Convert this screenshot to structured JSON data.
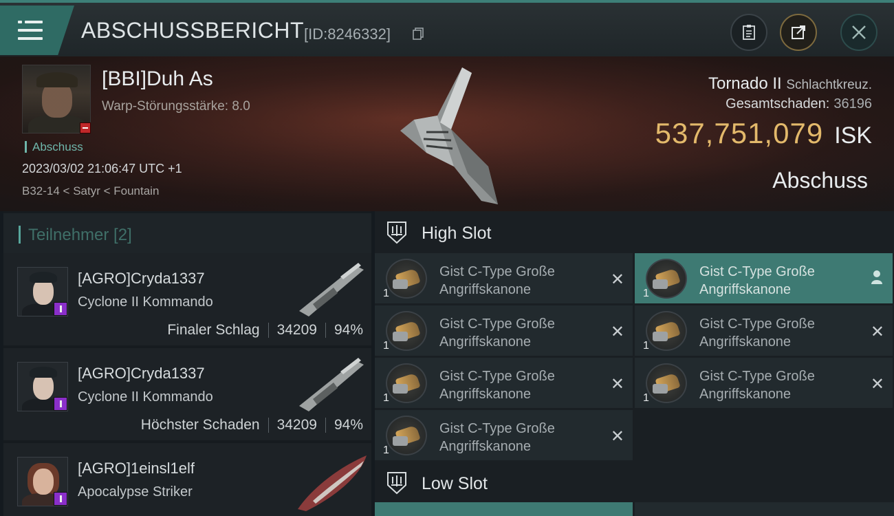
{
  "header": {
    "title": "ABSCHUSSBERICHT",
    "id_label": "[ID:8246332]",
    "icons": [
      "menu-icon",
      "copy-icon",
      "clipboard-icon",
      "share-icon",
      "close-icon"
    ]
  },
  "victim": {
    "name": "[BBI]Duh As",
    "warp_strength": "Warp-Störungsstärke: 8.0",
    "kill_tag": "Abschuss",
    "datetime": "2023/03/02 21:06:47 UTC +1",
    "location": "B32-14 < Satyr < Fountain",
    "ship": "Tornado II",
    "ship_class": "Schlachtkreuz.",
    "total_damage_label": "Gesamtschaden:",
    "total_damage": "36196",
    "isk_value": "537,751,079",
    "isk_unit": "ISK",
    "result": "Abschuss"
  },
  "participants": {
    "label": "Teilnehmer [2]",
    "rows": [
      {
        "name": "[AGRO]Cryda1337",
        "ship": "Cyclone II Kommando",
        "role": "Finaler Schlag",
        "damage": "34209",
        "percent": "94%"
      },
      {
        "name": "[AGRO]Cryda1337",
        "ship": "Cyclone II Kommando",
        "role": "Höchster Schaden",
        "damage": "34209",
        "percent": "94%"
      },
      {
        "name": "[AGRO]1einsl1elf",
        "ship": "Apocalypse Striker",
        "role": "",
        "damage": "",
        "percent": ""
      }
    ]
  },
  "slots": {
    "high_label": "High Slot",
    "low_label": "Low Slot",
    "high_modules": [
      {
        "line1": "Gist C-Type Große",
        "line2": "Angriffskanone",
        "qty": "1",
        "status": "destroyed"
      },
      {
        "line1": "Gist C-Type Große",
        "line2": "Angriffskanone",
        "qty": "1",
        "status": "dropped"
      },
      {
        "line1": "Gist C-Type Große",
        "line2": "Angriffskanone",
        "qty": "1",
        "status": "destroyed"
      },
      {
        "line1": "Gist C-Type Große",
        "line2": "Angriffskanone",
        "qty": "1",
        "status": "destroyed"
      },
      {
        "line1": "Gist C-Type Große",
        "line2": "Angriffskanone",
        "qty": "1",
        "status": "destroyed"
      },
      {
        "line1": "Gist C-Type Große",
        "line2": "Angriffskanone",
        "qty": "1",
        "status": "destroyed"
      },
      {
        "line1": "Gist C-Type Große",
        "line2": "Angriffskanone",
        "qty": "1",
        "status": "destroyed"
      }
    ],
    "destroyed_mark": "✕"
  },
  "colors": {
    "accent_teal": "#3e7a73",
    "isk_gold": "#e3b96b",
    "badge_red": "#c0282a",
    "badge_purple": "#8a2fc9"
  }
}
